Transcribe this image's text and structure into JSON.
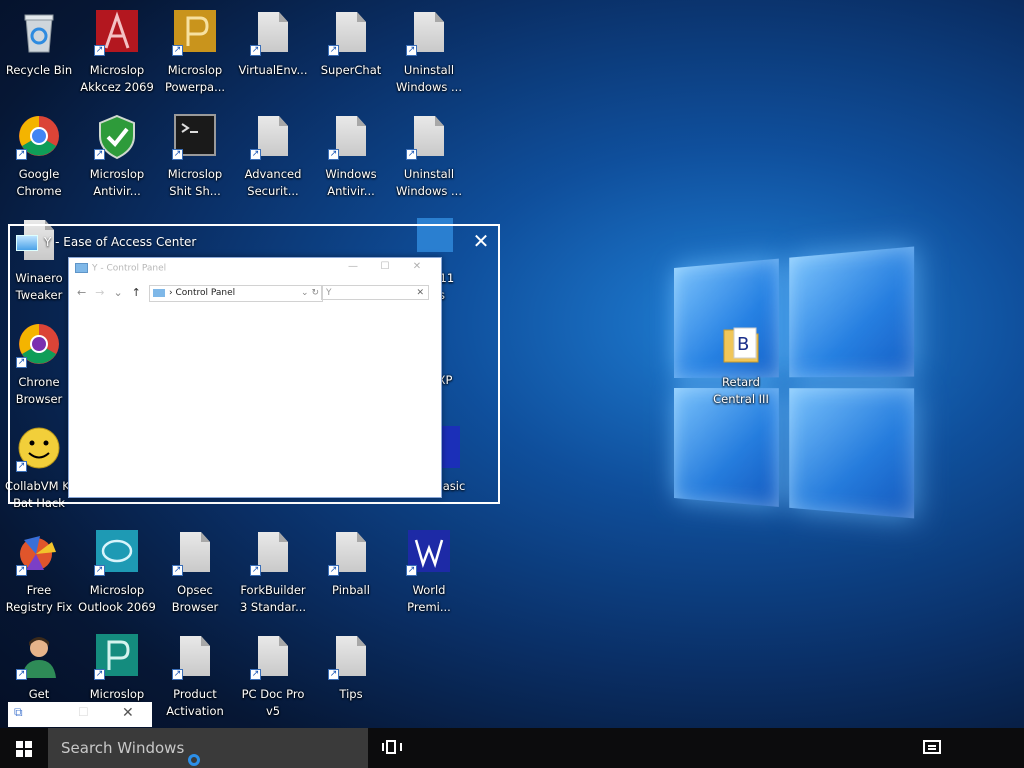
{
  "desktop": {
    "icons": [
      {
        "label": "Recycle Bin",
        "type": "recycle"
      },
      {
        "label": "Microslop\nAkkcez 2069",
        "type": "access"
      },
      {
        "label": "Microslop\nPowerpa...",
        "type": "powerpoint"
      },
      {
        "label": "VirtualEnv...",
        "type": "page"
      },
      {
        "label": "SuperChat",
        "type": "page"
      },
      {
        "label": "Uninstall\nWindows ...",
        "type": "page"
      },
      {
        "label": "Google\nChrome",
        "type": "chrome"
      },
      {
        "label": "Microslop\nAntivir...",
        "type": "shield"
      },
      {
        "label": "Microslop\nShit Sh...",
        "type": "terminal"
      },
      {
        "label": "Advanced\nSecurit...",
        "type": "page"
      },
      {
        "label": "Windows\nAntivir...",
        "type": "page"
      },
      {
        "label": "Uninstall\nWindows ...",
        "type": "page"
      },
      {
        "label": "Winaero\nTweaker",
        "type": "page"
      },
      {
        "label": "Chrone\nBrowser",
        "type": "chrome"
      },
      {
        "label": "CollabVM Ki\nBat Hack",
        "type": "smiley"
      },
      {
        "label": "Free\nRegistry Fix",
        "type": "registry"
      },
      {
        "label": "Microslop\nOutlook 2069",
        "type": "outlook"
      },
      {
        "label": "Opsec\nBrowser",
        "type": "page"
      },
      {
        "label": "ForkBuilder\n3 Standar...",
        "type": "page"
      },
      {
        "label": "Pinball",
        "type": "page"
      },
      {
        "label": "World\nPremi...",
        "type": "word"
      },
      {
        "label": "Get",
        "type": "person"
      },
      {
        "label": "Microslop",
        "type": "publisher"
      },
      {
        "label": "Product\nActivation",
        "type": "page"
      },
      {
        "label": "PC Doc Pro\nv5",
        "type": "page"
      },
      {
        "label": "Tips",
        "type": "page"
      },
      {
        "label": "Retard\nCentral III",
        "type": "folder"
      }
    ],
    "partial_labels": {
      "a": "s 11",
      "b": "s",
      "c": "XP",
      "d": "asic"
    }
  },
  "ease_window": {
    "title": "Y - Ease of Access Center",
    "close": "✕"
  },
  "control_panel": {
    "title": "Y - Control Panel",
    "minimize": "—",
    "maximize": "☐",
    "close": "✕",
    "nav_back": "←",
    "nav_forward": "→",
    "nav_dropdown": "⌄",
    "nav_up": "↑",
    "address": "Control Panel",
    "address_sep": "›",
    "address_dropdown": "⌄",
    "refresh": "↻",
    "search_value": "Y",
    "search_clear": "✕"
  },
  "mini_window": {
    "restore": "⧉",
    "maximize": "☐",
    "close": "✕"
  },
  "taskbar": {
    "search_placeholder": "Search Windows"
  },
  "colors": {
    "taskbar": "#0c0c0d",
    "search_box": "#3a3a3a",
    "accent": "#2c8fe8"
  }
}
